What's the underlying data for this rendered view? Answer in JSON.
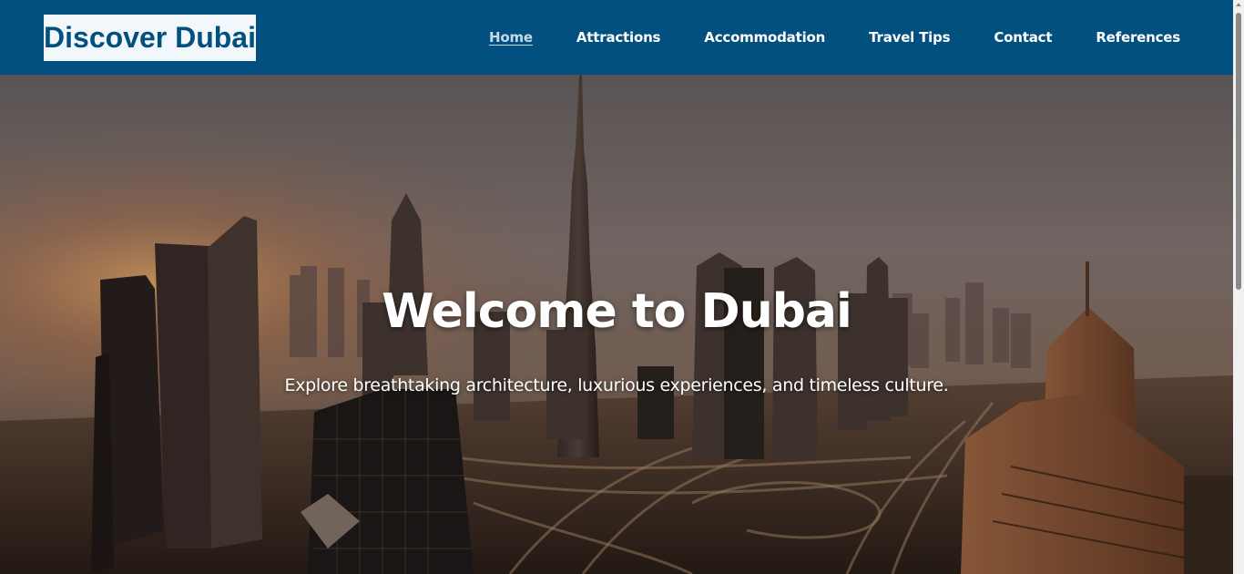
{
  "header": {
    "logo_text": "Discover Dubai",
    "nav": [
      {
        "label": "Home",
        "active": true
      },
      {
        "label": "Attractions",
        "active": false
      },
      {
        "label": "Accommodation",
        "active": false
      },
      {
        "label": "Travel Tips",
        "active": false
      },
      {
        "label": "Contact",
        "active": false
      },
      {
        "label": "References",
        "active": false
      }
    ]
  },
  "hero": {
    "title": "Welcome to Dubai",
    "subtitle": "Explore breathtaking architecture, luxurious experiences, and timeless culture.",
    "background": "dubai-skyline-photo"
  },
  "colors": {
    "header_bg": "#02507f",
    "logo_bg": "#f1f7fb",
    "nav_text": "#ffffff",
    "active_nav_text": "#c8d8e6"
  }
}
